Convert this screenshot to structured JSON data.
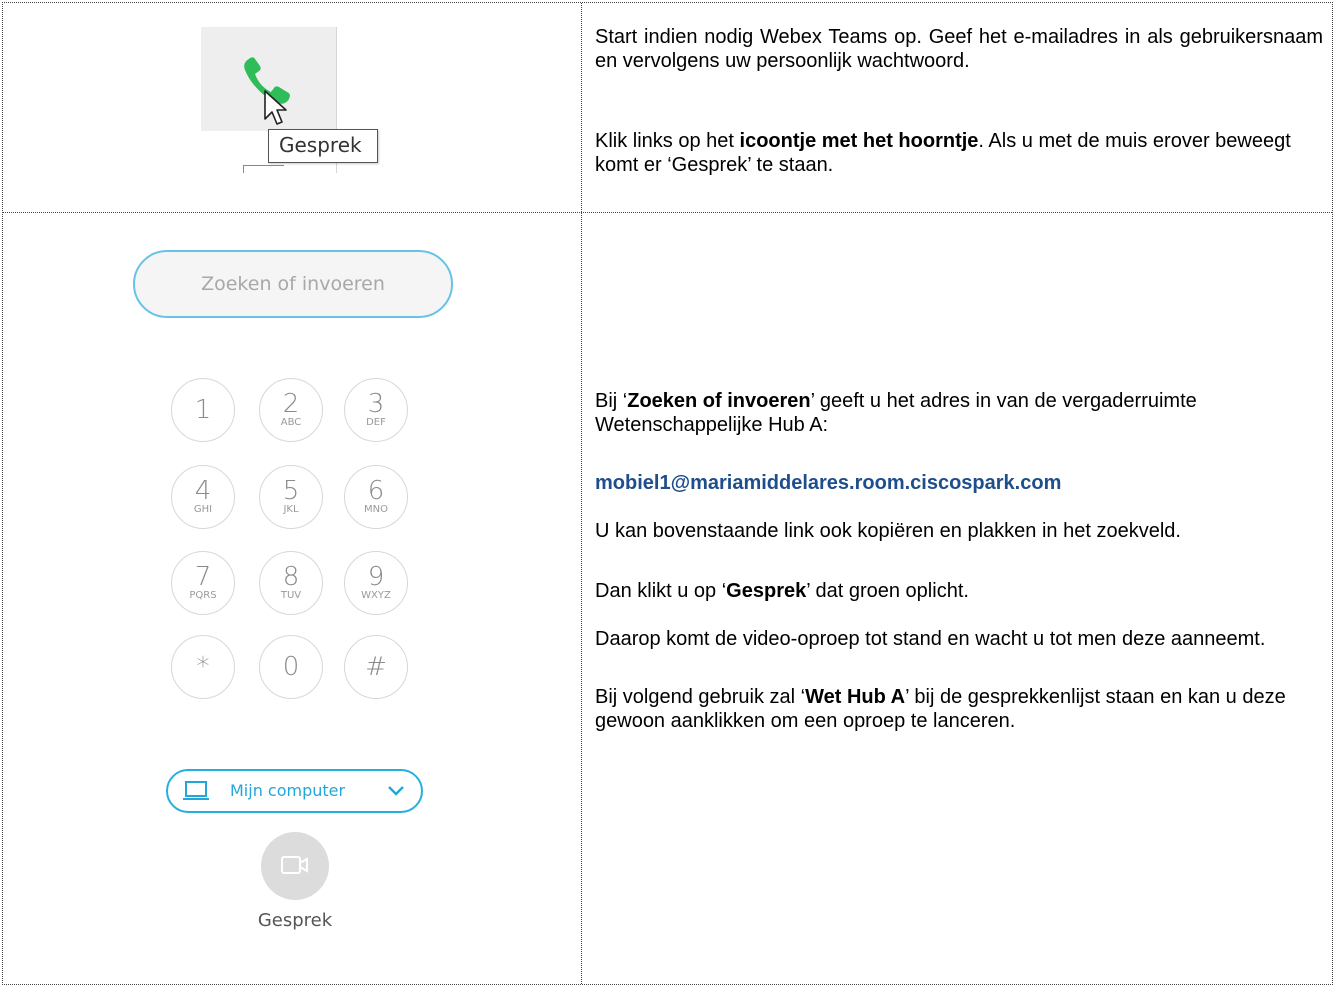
{
  "step1": {
    "tooltip": "Gesprek",
    "p1": "Start indien nodig Webex Teams op. Geef het e-mailadres in als gebruikersnaam en vervolgens uw persoonlijk wachtwoord.",
    "p2_pre": "Klik links op het ",
    "p2_bold": "icoontje met het hoorntje",
    "p2_post": ". Als u met de muis erover beweegt komt er ‘Gesprek’ te staan."
  },
  "dialer": {
    "search_placeholder": "Zoeken of invoeren",
    "keys": [
      {
        "digit": "1",
        "letters": ""
      },
      {
        "digit": "2",
        "letters": "ABC"
      },
      {
        "digit": "3",
        "letters": "DEF"
      },
      {
        "digit": "4",
        "letters": "GHI"
      },
      {
        "digit": "5",
        "letters": "JKL"
      },
      {
        "digit": "6",
        "letters": "MNO"
      },
      {
        "digit": "7",
        "letters": "PQRS"
      },
      {
        "digit": "8",
        "letters": "TUV"
      },
      {
        "digit": "9",
        "letters": "WXYZ"
      },
      {
        "digit": "*",
        "letters": ""
      },
      {
        "digit": "0",
        "letters": ""
      },
      {
        "digit": "#",
        "letters": ""
      }
    ],
    "device_label": "Mijn computer",
    "call_label": "Gesprek"
  },
  "step2": {
    "p1_pre": "Bij ‘",
    "p1_bold": "Zoeken of invoeren",
    "p1_post": "’ geeft u het adres in van de vergaderruimte Wetenschappelijke Hub A:",
    "address": "mobiel1@mariamiddelares.room.ciscospark.com",
    "p3": "U kan bovenstaande link ook kopiëren en plakken in het zoekveld.",
    "p4_pre": "Dan klikt u op ‘",
    "p4_bold": "Gesprek",
    "p4_post": "’ dat groen oplicht.",
    "p5": "Daarop komt de video-oproep tot stand en wacht u tot men deze aanneemt.",
    "p6_pre": "Bij volgend gebruik zal ‘",
    "p6_bold": "Wet Hub A",
    "p6_post": "’ bij de gesprekkenlijst staan en kan u deze gewoon aanklikken om een oproep te lanceren."
  },
  "colors": {
    "phone_green": "#2ebd59",
    "accent_blue": "#27aee0",
    "link_blue": "#1f4e8c"
  }
}
